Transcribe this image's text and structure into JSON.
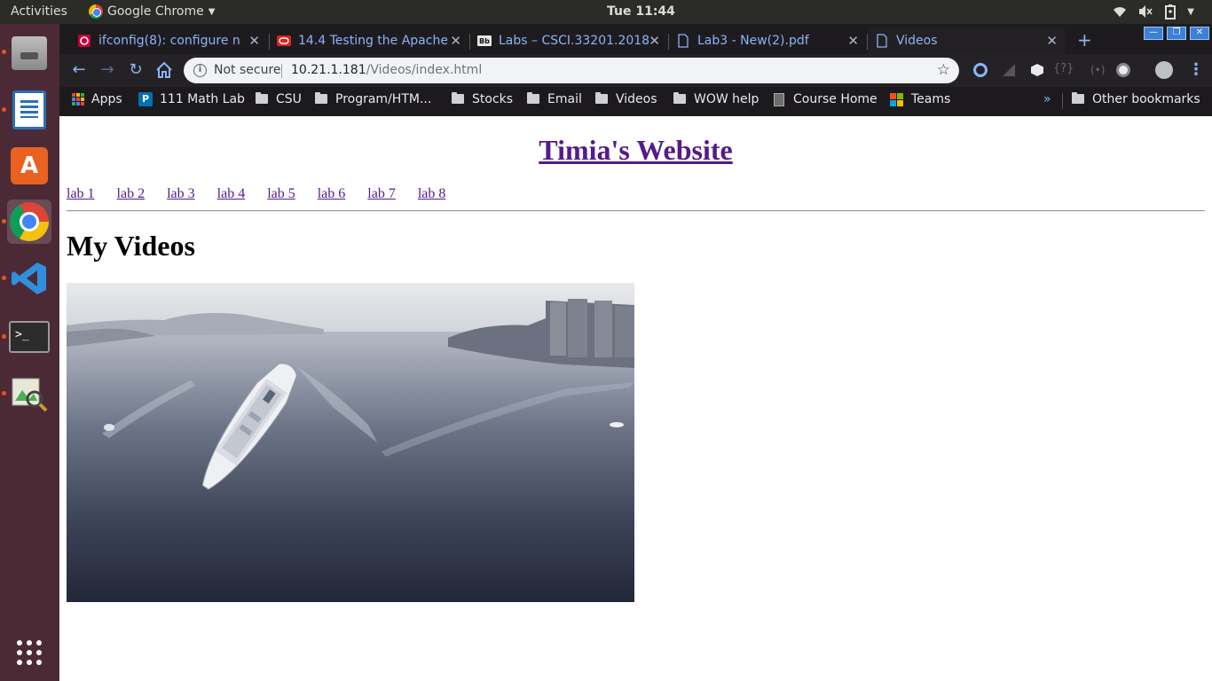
{
  "topbar": {
    "activities": "Activities",
    "app_name": "Google Chrome",
    "clock": "Tue 11:44"
  },
  "tabs": [
    {
      "title": "ifconfig(8): configure n",
      "icon": "debian-icon"
    },
    {
      "title": "14.4 Testing the Apache",
      "icon": "oracle-icon"
    },
    {
      "title": "Labs – CSCI.33201.2018",
      "icon": "blackboard-icon"
    },
    {
      "title": "Lab3 - New(2).pdf",
      "icon": "document-icon"
    },
    {
      "title": "Videos",
      "icon": "document-icon",
      "active": true
    }
  ],
  "omnibox": {
    "security": "Not secure",
    "url_host": "10.21.1.181",
    "url_path": "/Videos/index.html"
  },
  "bookmarks": {
    "items": [
      "Apps",
      "111 Math Lab",
      "CSU",
      "Program/HTM...",
      "Stocks",
      "Email",
      "Videos",
      "WOW help",
      "Course Home",
      "Teams"
    ],
    "other": "Other bookmarks"
  },
  "page": {
    "site_title": "Timia's Website",
    "nav": [
      "lab 1",
      "lab 2",
      "lab 3",
      "lab 4",
      "lab 5",
      "lab 6",
      "lab 7",
      "lab 8"
    ],
    "heading": "My Videos"
  },
  "colors": {
    "link_visited": "#551a8b",
    "dock_bg": "#4b2a36",
    "chrome_accent": "#8ab4f8"
  }
}
